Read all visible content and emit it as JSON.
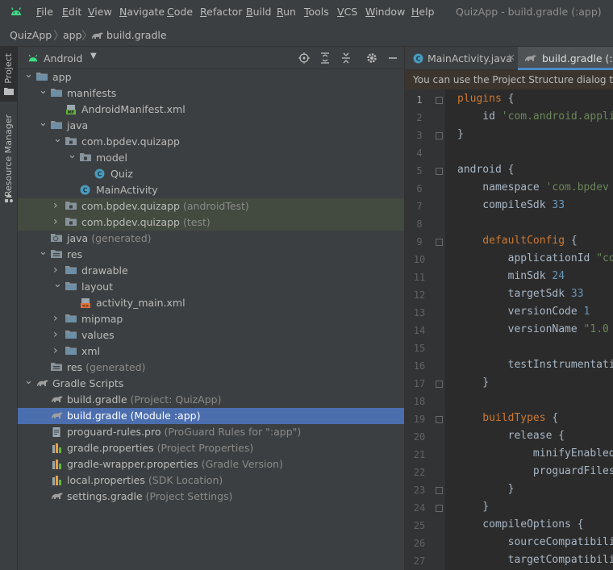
{
  "menubar": {
    "items": [
      "File",
      "Edit",
      "View",
      "Navigate",
      "Code",
      "Refactor",
      "Build",
      "Run",
      "Tools",
      "VCS",
      "Window",
      "Help"
    ],
    "window_title": "QuizApp - build.gradle (:app)"
  },
  "breadcrumb": {
    "project": "QuizApp",
    "module": "app",
    "file": "build.gradle"
  },
  "toolstrip": {
    "project_label": "Project",
    "resource_label": "Resource Manager"
  },
  "project_panel": {
    "view_mode": "Android",
    "tree": [
      {
        "label": "app",
        "hint": "",
        "depth": 0,
        "arrow": "down",
        "icon": "folder-icon"
      },
      {
        "label": "manifests",
        "hint": "",
        "depth": 1,
        "arrow": "down",
        "icon": "folder-icon"
      },
      {
        "label": "AndroidManifest.xml",
        "hint": "",
        "depth": 2,
        "arrow": "",
        "icon": "manifest-file-icon"
      },
      {
        "label": "java",
        "hint": "",
        "depth": 1,
        "arrow": "down",
        "icon": "folder-icon"
      },
      {
        "label": "com.bpdev.quizapp",
        "hint": "",
        "depth": 2,
        "arrow": "down",
        "icon": "package-icon"
      },
      {
        "label": "model",
        "hint": "",
        "depth": 3,
        "arrow": "down",
        "icon": "package-icon"
      },
      {
        "label": "Quiz",
        "hint": "",
        "depth": 4,
        "arrow": "",
        "icon": "class-icon"
      },
      {
        "label": "MainActivity",
        "hint": "",
        "depth": 3,
        "arrow": "",
        "icon": "class-icon"
      },
      {
        "label": "com.bpdev.quizapp",
        "hint": "(androidTest)",
        "depth": 2,
        "arrow": "right",
        "icon": "package-icon",
        "highlight": "green"
      },
      {
        "label": "com.bpdev.quizapp",
        "hint": "(test)",
        "depth": 2,
        "arrow": "right",
        "icon": "package-icon",
        "highlight": "green"
      },
      {
        "label": "java",
        "hint": "(generated)",
        "depth": 1,
        "arrow": "",
        "icon": "generated-folder-icon"
      },
      {
        "label": "res",
        "hint": "",
        "depth": 1,
        "arrow": "down",
        "icon": "res-folder-icon"
      },
      {
        "label": "drawable",
        "hint": "",
        "depth": 2,
        "arrow": "right",
        "icon": "folder-icon"
      },
      {
        "label": "layout",
        "hint": "",
        "depth": 2,
        "arrow": "down",
        "icon": "folder-icon"
      },
      {
        "label": "activity_main.xml",
        "hint": "",
        "depth": 3,
        "arrow": "",
        "icon": "layout-file-icon"
      },
      {
        "label": "mipmap",
        "hint": "",
        "depth": 2,
        "arrow": "right",
        "icon": "folder-icon"
      },
      {
        "label": "values",
        "hint": "",
        "depth": 2,
        "arrow": "right",
        "icon": "folder-icon"
      },
      {
        "label": "xml",
        "hint": "",
        "depth": 2,
        "arrow": "right",
        "icon": "folder-icon"
      },
      {
        "label": "res",
        "hint": "(generated)",
        "depth": 1,
        "arrow": "",
        "icon": "res-folder-icon"
      },
      {
        "label": "Gradle Scripts",
        "hint": "",
        "depth": 0,
        "arrow": "down",
        "icon": "gradle-icon"
      },
      {
        "label": "build.gradle",
        "hint": "(Project: QuizApp)",
        "depth": 1,
        "arrow": "",
        "icon": "gradle-icon"
      },
      {
        "label": "build.gradle",
        "hint": "(Module :app)",
        "depth": 1,
        "arrow": "",
        "icon": "gradle-icon",
        "highlight": "selected"
      },
      {
        "label": "proguard-rules.pro",
        "hint": "(ProGuard Rules for \":app\")",
        "depth": 1,
        "arrow": "",
        "icon": "text-file-icon"
      },
      {
        "label": "gradle.properties",
        "hint": "(Project Properties)",
        "depth": 1,
        "arrow": "",
        "icon": "properties-file-icon"
      },
      {
        "label": "gradle-wrapper.properties",
        "hint": "(Gradle Version)",
        "depth": 1,
        "arrow": "",
        "icon": "properties-file-icon"
      },
      {
        "label": "local.properties",
        "hint": "(SDK Location)",
        "depth": 1,
        "arrow": "",
        "icon": "properties-file-icon"
      },
      {
        "label": "settings.gradle",
        "hint": "(Project Settings)",
        "depth": 1,
        "arrow": "",
        "icon": "gradle-icon"
      }
    ]
  },
  "editor": {
    "tabs": [
      {
        "label": "MainActivity.java",
        "icon": "class-icon",
        "active": false
      },
      {
        "label": "build.gradle (:app",
        "icon": "gradle-icon",
        "active": true
      }
    ],
    "banner": "You can use the Project Structure dialog to view and edit your project configuration",
    "lines": [
      {
        "n": "1",
        "t": [
          [
            "kw",
            "plugins"
          ],
          [
            "fn",
            " {"
          ]
        ]
      },
      {
        "n": "2",
        "t": [
          [
            "fn",
            "    id "
          ],
          [
            "str",
            "'com.android.appli"
          ]
        ]
      },
      {
        "n": "3",
        "t": [
          [
            "fn",
            "}"
          ]
        ]
      },
      {
        "n": "4",
        "t": []
      },
      {
        "n": "5",
        "t": [
          [
            "fn",
            "android {"
          ]
        ]
      },
      {
        "n": "6",
        "t": [
          [
            "fn",
            "    namespace "
          ],
          [
            "str",
            "'com.bpdev"
          ]
        ]
      },
      {
        "n": "7",
        "t": [
          [
            "fn",
            "    compileSdk "
          ],
          [
            "num",
            "33"
          ]
        ]
      },
      {
        "n": "8",
        "t": []
      },
      {
        "n": "9",
        "t": [
          [
            "kw",
            "    defaultConfig"
          ],
          [
            "fn",
            " {"
          ]
        ]
      },
      {
        "n": "10",
        "t": [
          [
            "fn",
            "        applicationId "
          ],
          [
            "str",
            "\"co"
          ]
        ]
      },
      {
        "n": "11",
        "t": [
          [
            "fn",
            "        minSdk "
          ],
          [
            "num",
            "24"
          ]
        ]
      },
      {
        "n": "12",
        "t": [
          [
            "fn",
            "        targetSdk "
          ],
          [
            "num",
            "33"
          ]
        ]
      },
      {
        "n": "13",
        "t": [
          [
            "fn",
            "        versionCode "
          ],
          [
            "num",
            "1"
          ]
        ]
      },
      {
        "n": "14",
        "t": [
          [
            "fn",
            "        versionName "
          ],
          [
            "str",
            "\"1.0"
          ]
        ]
      },
      {
        "n": "15",
        "t": []
      },
      {
        "n": "16",
        "t": [
          [
            "fn",
            "        testInstrumentati"
          ]
        ]
      },
      {
        "n": "17",
        "t": [
          [
            "fn",
            "    }"
          ]
        ]
      },
      {
        "n": "18",
        "t": []
      },
      {
        "n": "19",
        "t": [
          [
            "kw",
            "    buildTypes"
          ],
          [
            "fn",
            " {"
          ]
        ]
      },
      {
        "n": "20",
        "t": [
          [
            "fn",
            "        release {"
          ]
        ]
      },
      {
        "n": "21",
        "t": [
          [
            "fn",
            "            minifyEnabled"
          ]
        ]
      },
      {
        "n": "22",
        "t": [
          [
            "fn",
            "            proguardFiles"
          ]
        ]
      },
      {
        "n": "23",
        "t": [
          [
            "fn",
            "        }"
          ]
        ]
      },
      {
        "n": "24",
        "t": [
          [
            "fn",
            "    }"
          ]
        ]
      },
      {
        "n": "25",
        "t": [
          [
            "fn",
            "    compileOptions {"
          ]
        ]
      },
      {
        "n": "26",
        "t": [
          [
            "fn",
            "        sourceCompatibili"
          ]
        ]
      },
      {
        "n": "27",
        "t": [
          [
            "fn",
            "        targetCompatibili"
          ]
        ]
      }
    ]
  },
  "colors": {
    "accent": "#4a88c7",
    "selection": "#4b6eaf",
    "test_highlight": "#434a3f",
    "android_green": "#3ddc84"
  }
}
